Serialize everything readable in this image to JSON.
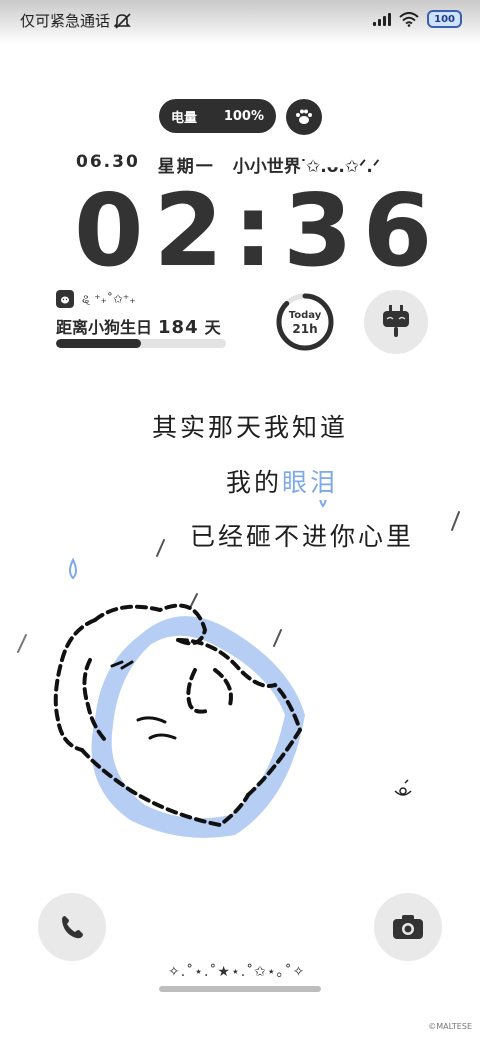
{
  "status_bar": {
    "carrier": "仅可紧急通话",
    "battery": "100"
  },
  "battery_widget": {
    "label": "电量",
    "value": "100%"
  },
  "date_line": {
    "date": "06.30",
    "weekday": "星期一",
    "text": "小小世界ᐝ✩.ᴗ.✩ᐟ.ᐟ"
  },
  "clock": {
    "time": "02:36"
  },
  "countdown": {
    "deco": "ୡ ⁺₊˚✩⁺₊",
    "label": "距离小狗生日",
    "days": "184",
    "unit": "天",
    "progress": 0.5
  },
  "today_ring": {
    "label": "Today",
    "value": "21h",
    "progress": 0.875
  },
  "lyrics": {
    "line1": "其实那天我知道",
    "line2_a": "我的",
    "line2_b": "眼泪",
    "line3": "已经砸不进你心里"
  },
  "bottom": {
    "stars": "✧.˚⋆.˚★⋆.˚✩⋆｡˚✧"
  },
  "credit": "©MALTESE",
  "colors": {
    "accent_blue": "#7fa9e6",
    "dark": "#2f2f2f",
    "light_gray": "#e9e9e9"
  }
}
